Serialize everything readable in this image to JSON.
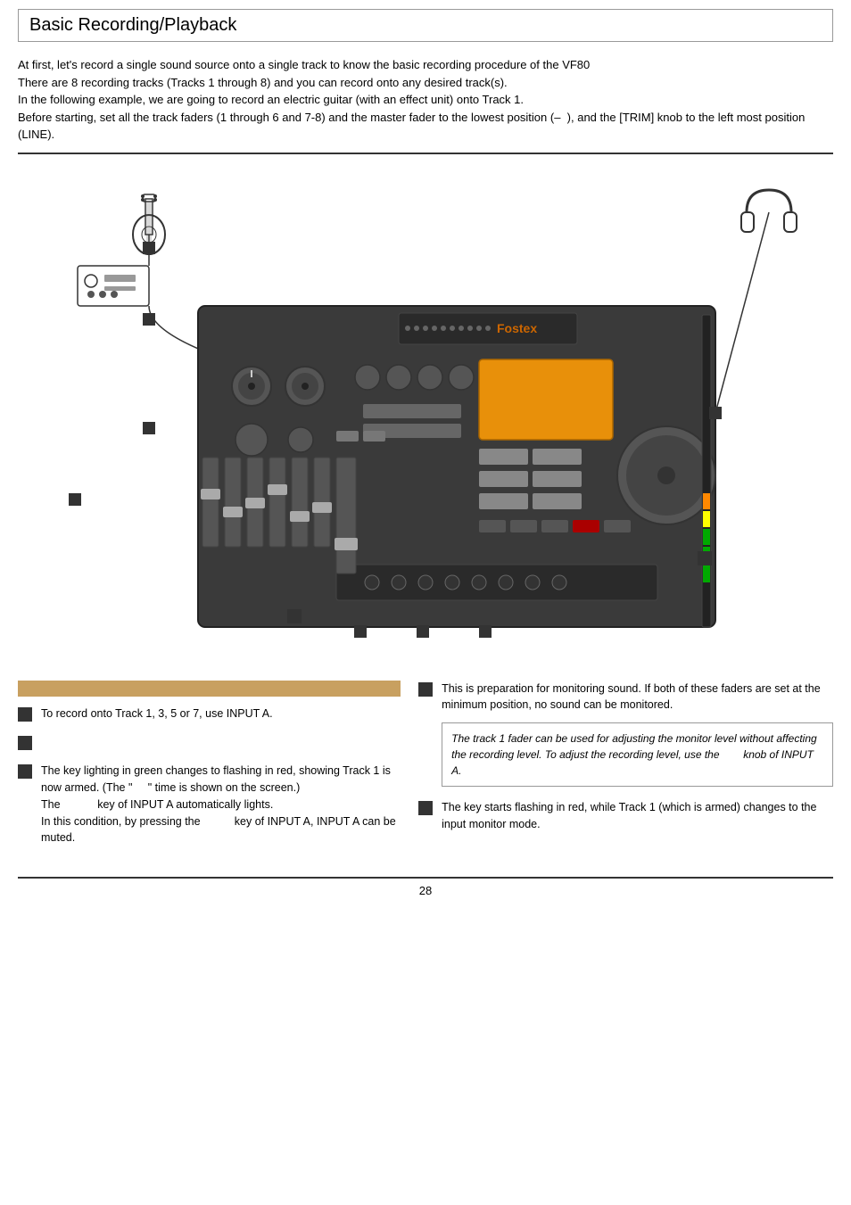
{
  "page": {
    "title": "Basic Recording/Playback",
    "footer_page": "28"
  },
  "intro": {
    "text": "At first, let's record a single sound source onto a single track to know the basic recording procedure of the VF80\nThere are 8 recording tracks (Tracks 1 through 8) and you can record onto any desired track(s).\nIn the following example, we are going to record an electric guitar (with an effect unit) onto Track 1.\nBefore starting, set all the track faders (1 through 6 and 7-8) and the master fader to the lowest position (–  ), and the [TRIM] knob to the left most position (LINE)."
  },
  "steps_left": [
    {
      "id": "step1",
      "text": "To record onto Track 1, 3, 5 or 7, use INPUT A."
    },
    {
      "id": "step2",
      "text": ""
    },
    {
      "id": "step3",
      "text": "The key lighting in green changes to flashing in red, showing Track 1 is now armed. (The \"     \" time is shown on the screen.)\nThe              key of INPUT A automatically lights.\nIn this condition, by pressing the              key of INPUT A, INPUT A can be muted."
    }
  ],
  "steps_right": [
    {
      "id": "step_r1",
      "text": "This is preparation for monitoring sound. If both of these faders are set at the minimum position, no sound can be monitored.",
      "has_note": true,
      "note": "The track 1 fader can be used for adjusting the monitor level without affecting the recording level. To adjust the recording level, use the        knob of INPUT A."
    },
    {
      "id": "step_r2",
      "text": "The key starts flashing in red, while Track 1 (which is armed) changes to the input monitor mode."
    }
  ],
  "icons": {
    "step_square": "■"
  }
}
